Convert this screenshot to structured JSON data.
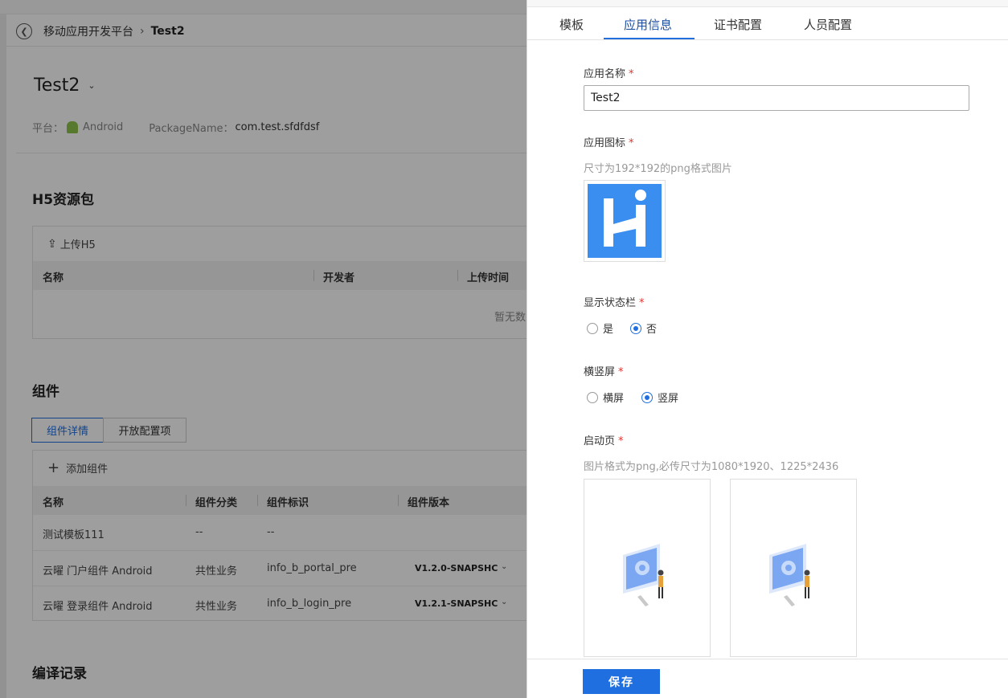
{
  "breadcrumb": {
    "root": "移动应用开发平台",
    "current": "Test2"
  },
  "app": {
    "name": "Test2",
    "platform_label": "平台：",
    "platform": "Android",
    "package_label": "PackageName：",
    "package": "com.test.sfdfdsf"
  },
  "h5": {
    "title": "H5资源包",
    "upload": "上传H5",
    "columns": [
      "名称",
      "开发者",
      "上传时间"
    ],
    "empty": "暂无数"
  },
  "components": {
    "title": "组件",
    "tabs": [
      "组件详情",
      "开放配置项"
    ],
    "add": "添加组件",
    "columns": [
      "名称",
      "组件分类",
      "组件标识",
      "组件版本"
    ],
    "rows": [
      {
        "name": "测试模板111",
        "category": "--",
        "id": "--",
        "version": ""
      },
      {
        "name": "云曜 门户组件 Android",
        "category": "共性业务",
        "id": "info_b_portal_pre",
        "version": "V1.2.0-SNAPSHC"
      },
      {
        "name": "云曜 登录组件 Android",
        "category": "共性业务",
        "id": "info_b_login_pre",
        "version": "V1.2.1-SNAPSHC"
      }
    ]
  },
  "build": {
    "title": "编译记录"
  },
  "drawer": {
    "tabs": [
      "模板",
      "应用信息",
      "证书配置",
      "人员配置"
    ],
    "active_tab": "应用信息",
    "app_name_label": "应用名称",
    "app_name_value": "Test2",
    "icon_label": "应用图标",
    "icon_hint": "尺寸为192*192的png格式图片",
    "statusbar_label": "显示状态栏",
    "statusbar_options": [
      "是",
      "否"
    ],
    "statusbar_selected": "否",
    "orientation_label": "横竖屏",
    "orientation_options": [
      "横屏",
      "竖屏"
    ],
    "orientation_selected": "竖屏",
    "splash_label": "启动页",
    "splash_hint": "图片格式为png,必传尺寸为1080*1920、1225*2436",
    "save": "保存",
    "required_mark": "*"
  },
  "colors": {
    "primary": "#1f6fe0",
    "required": "#e0342f",
    "icon_bg": "#3a8ef0"
  }
}
